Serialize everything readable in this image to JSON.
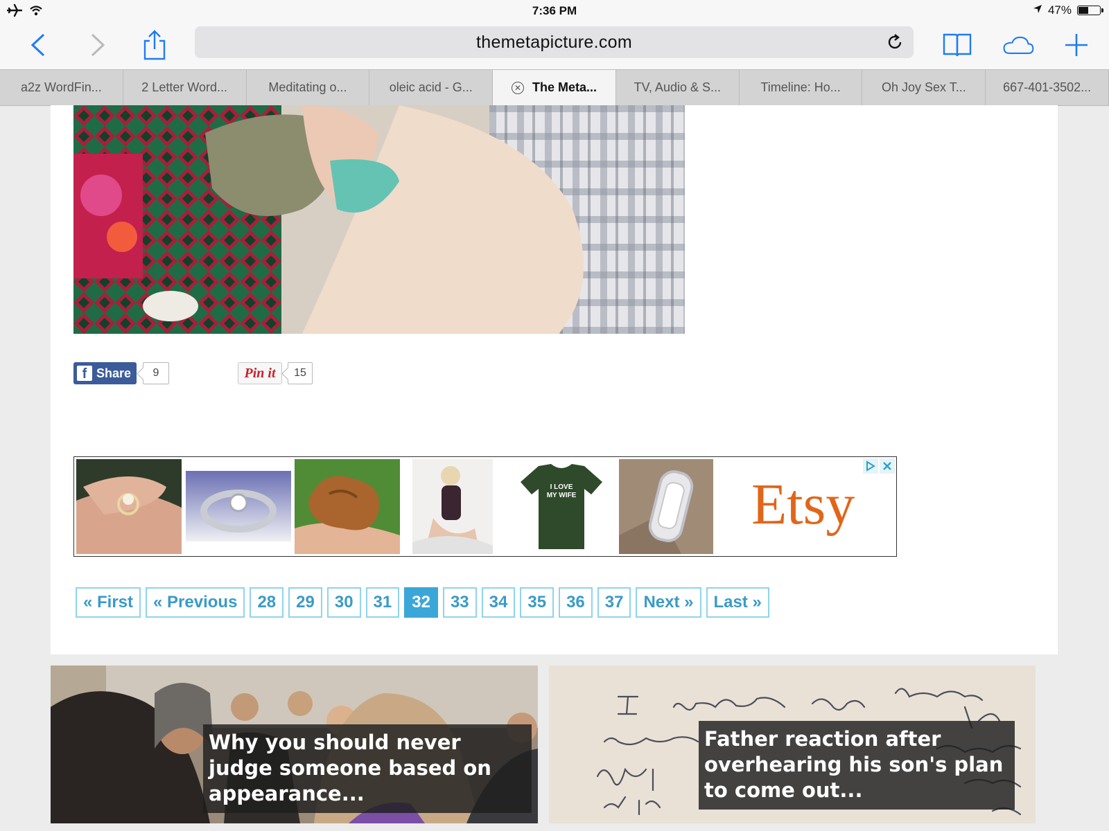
{
  "status_bar": {
    "time": "7:36 PM",
    "battery_percent": "47%",
    "battery_level": 0.47
  },
  "toolbar": {
    "url": "themetapicture.com"
  },
  "tabs": [
    {
      "label": "a2z WordFin..."
    },
    {
      "label": "2 Letter Word..."
    },
    {
      "label": "Meditating o..."
    },
    {
      "label": "oleic acid - G..."
    },
    {
      "label": "The Meta...",
      "active": true
    },
    {
      "label": "TV, Audio & S..."
    },
    {
      "label": "Timeline: Ho..."
    },
    {
      "label": "Oh Joy Sex T..."
    },
    {
      "label": "667-401-3502..."
    }
  ],
  "share": {
    "facebook_label": "Share",
    "facebook_count": "9",
    "pinterest_label": "Pin it",
    "pinterest_count": "15"
  },
  "ad": {
    "shirt_text_line1": "I LOVE",
    "shirt_text_line2": "MY WIFE",
    "brand": "Etsy"
  },
  "pagination": {
    "first": "« First",
    "previous": "« Previous",
    "pages": [
      "28",
      "29",
      "30",
      "31",
      "32",
      "33",
      "34",
      "35",
      "36",
      "37"
    ],
    "current": "32",
    "next": "Next »",
    "last": "Last »"
  },
  "promos": [
    {
      "caption": "Why you should never judge someone based on appearance..."
    },
    {
      "caption": "Father reaction after overhearing his son's plan to come out..."
    }
  ],
  "colors": {
    "accent": "#3ba7d8",
    "facebook": "#3b5b9a",
    "pinterest": "#c8232c",
    "etsy": "#e0661a",
    "safari_blue": "#1e7cf2"
  }
}
